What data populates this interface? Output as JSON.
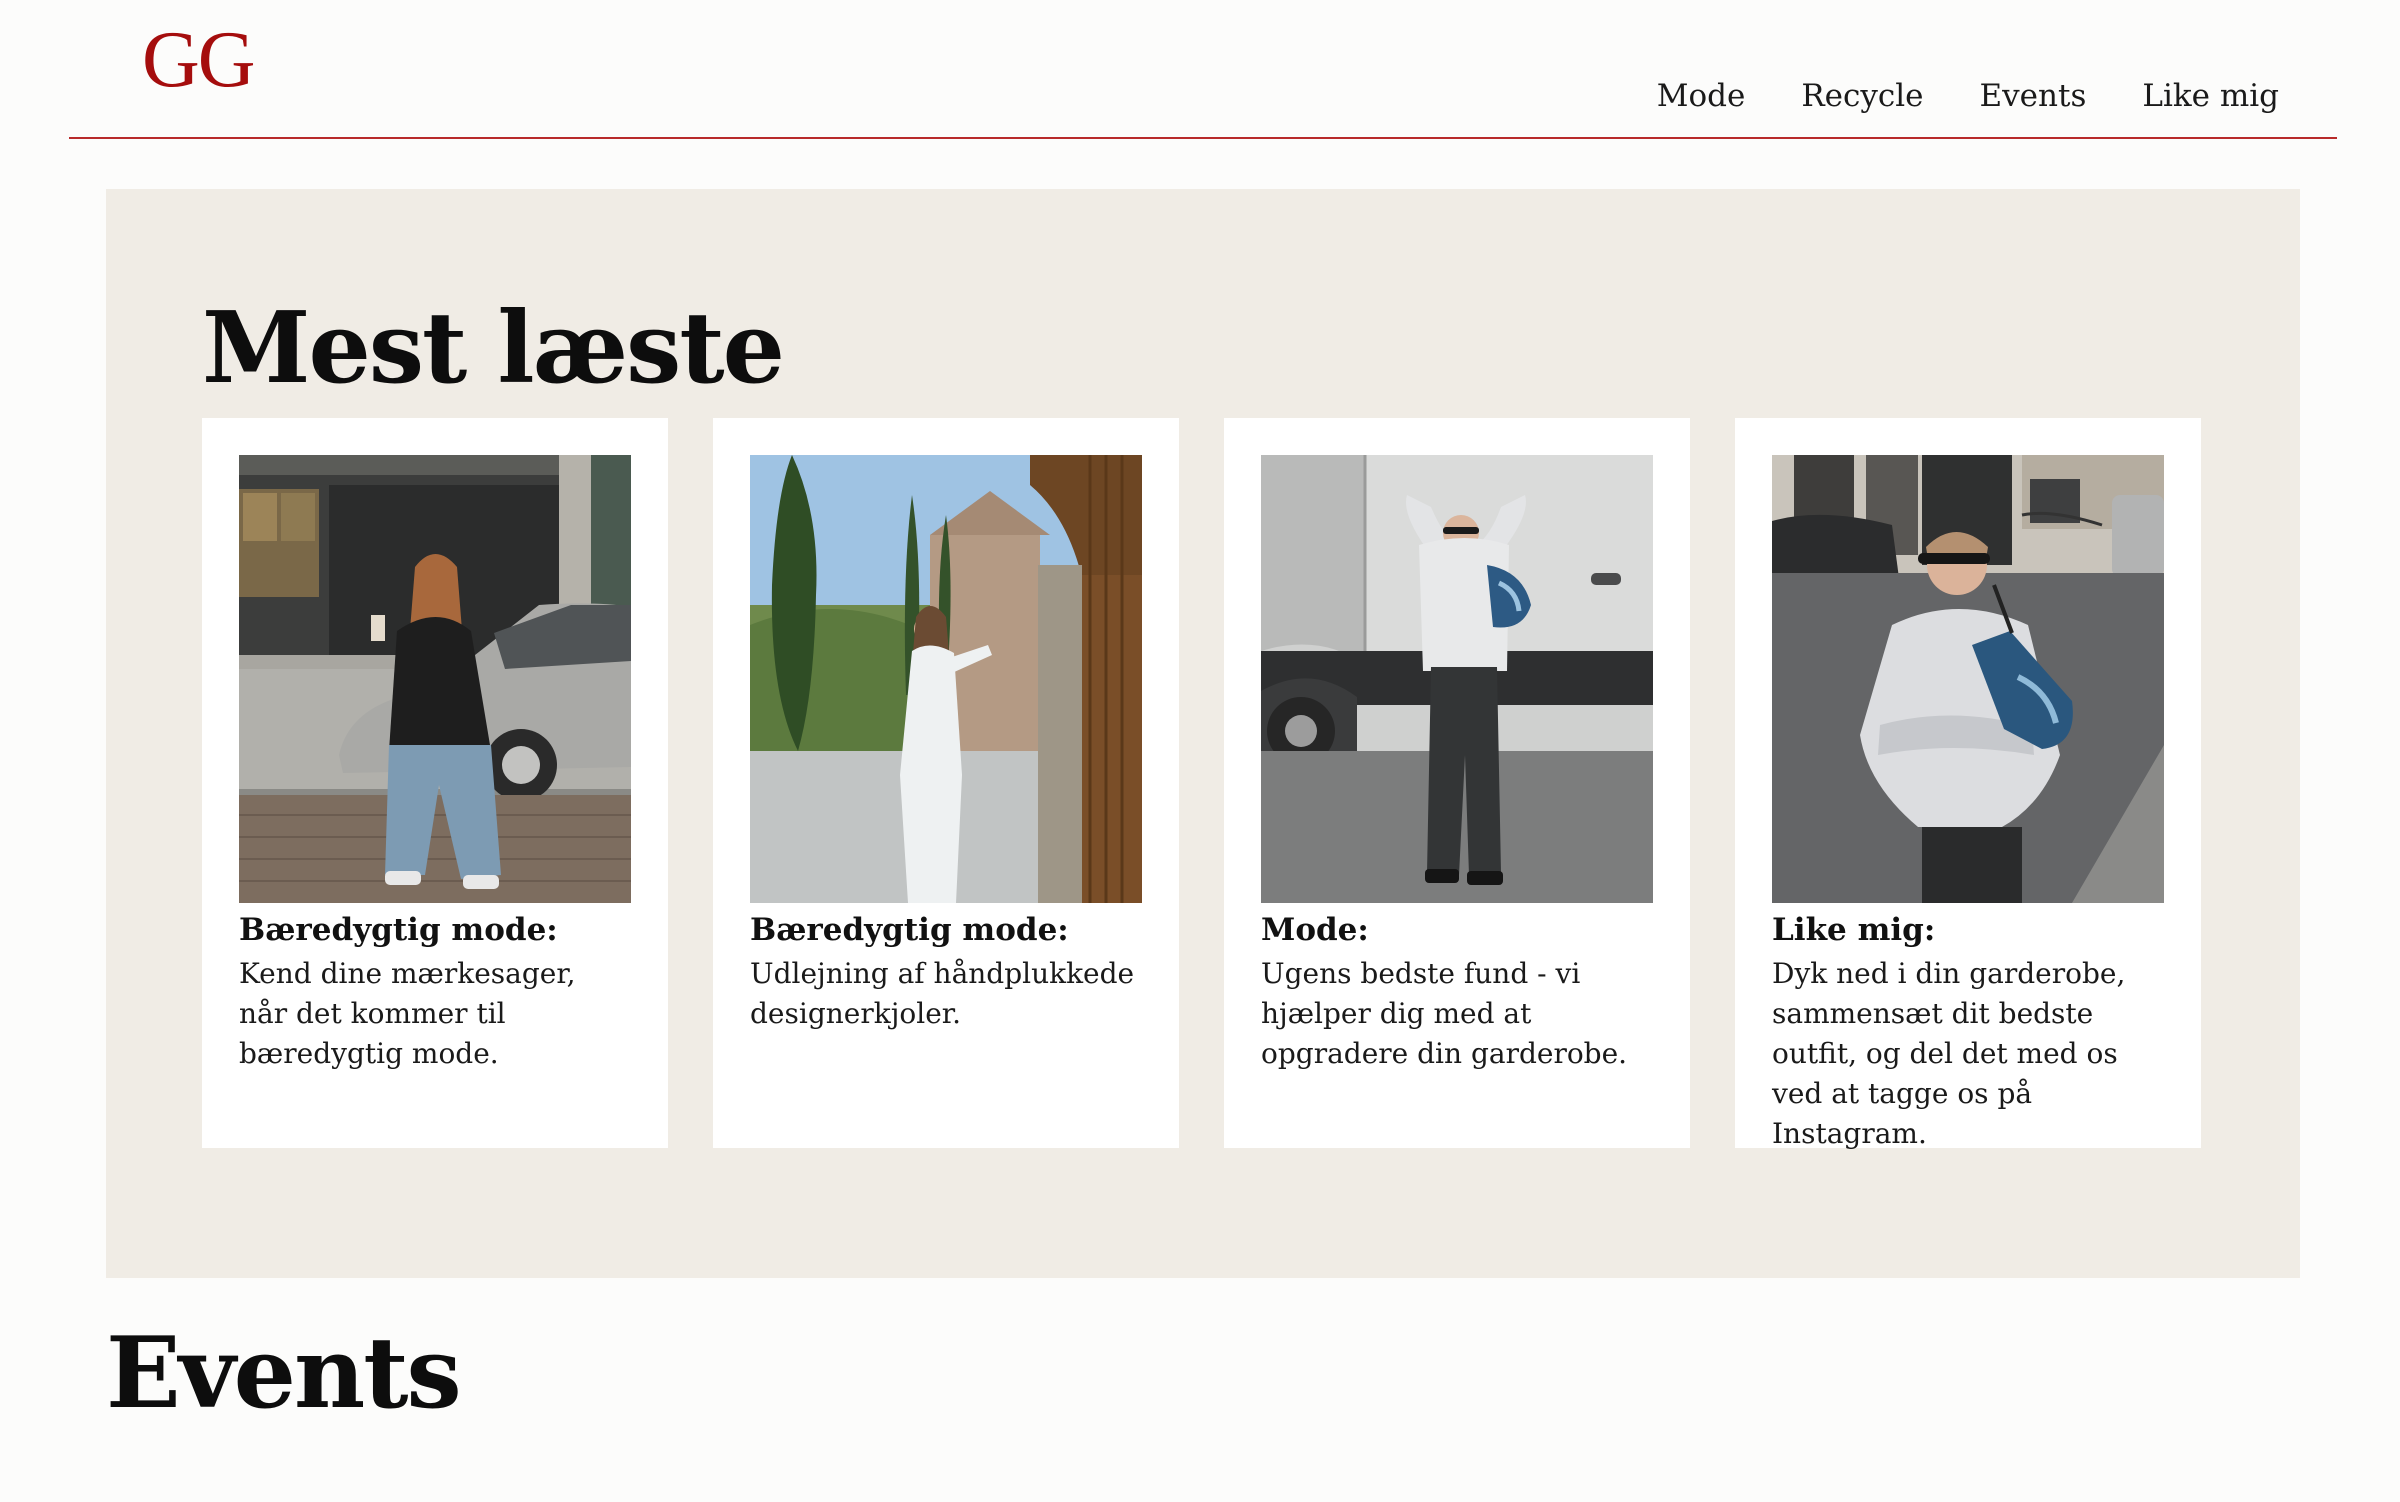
{
  "header": {
    "logo": "GG",
    "nav": [
      {
        "label": "Mode"
      },
      {
        "label": "Recycle"
      },
      {
        "label": "Events"
      },
      {
        "label": "Like mig"
      }
    ]
  },
  "featured": {
    "title": "Mest læste",
    "cards": [
      {
        "heading": "Bæredygtig mode:",
        "text": "Kend dine mærkesager, når det kommer til bæredygtig mode.",
        "image": "photo-woman-street-car"
      },
      {
        "heading": "Bæredygtig mode:",
        "text": "Udlejning af håndplukkede designerkjoler.",
        "image": "photo-woman-white-dress-doorway"
      },
      {
        "heading": "Mode:",
        "text": "Ugens bedste fund - vi hjælper dig med at opgradere din garderobe.",
        "image": "photo-person-hoodie-van"
      },
      {
        "heading": "Like mig:",
        "text": "Dyk ned i din garderobe, sammensæt dit bedste outfit, og del det med os ved at tagge os på Instagram.",
        "image": "photo-woman-hoodie-street"
      }
    ]
  },
  "events": {
    "title": "Events"
  },
  "colors": {
    "accent": "#a50d0d",
    "header_rule": "#b82a2a",
    "section_bg": "#f0ece5",
    "card_bg": "#ffffff"
  }
}
